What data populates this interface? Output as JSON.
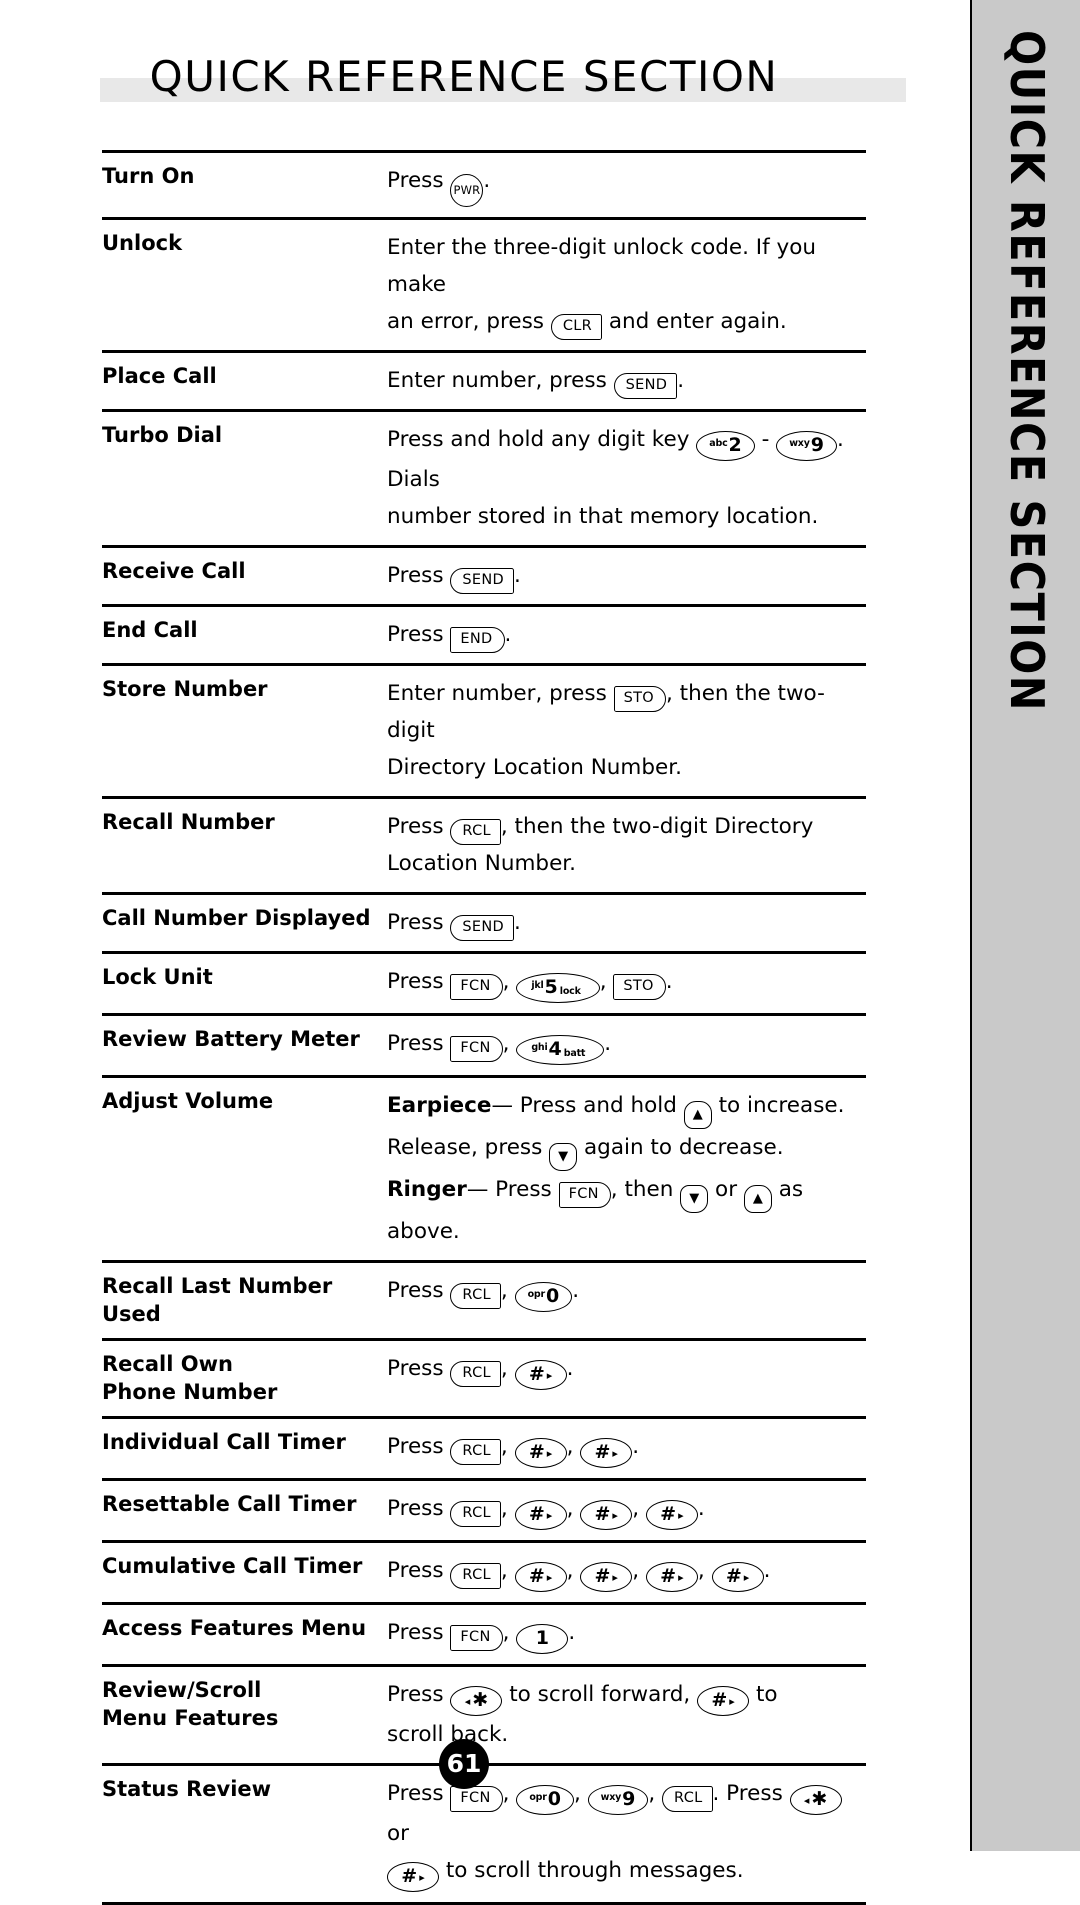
{
  "header": {
    "title": "QUICK REFERENCE SECTION",
    "band_color": "#e8e8e8"
  },
  "side_tab": {
    "label": "QUICK REFERENCE SECTION",
    "background": "#c9c9c9"
  },
  "page_number": "61",
  "keys": {
    "pwr": "PWR",
    "clr": "CLR",
    "send": "SEND",
    "end": "END",
    "sto": "STO",
    "rcl": "RCL",
    "fcn": "FCN",
    "digit_1": "1",
    "digit_2": "2",
    "digit_2_letters": "abc",
    "digit_4": "4",
    "digit_4_letters": "ghi",
    "digit_4_sub": "batt",
    "digit_5": "5",
    "digit_5_letters": "jkl",
    "digit_5_sub": "lock",
    "digit_9": "9",
    "digit_9_letters": "wxy",
    "digit_0": "0",
    "digit_0_letters": "opr",
    "hash": "#",
    "star": "✱",
    "tri_right": "▸",
    "tri_left": "◂",
    "arrow_up": "▲",
    "arrow_down": "▼"
  },
  "rows": [
    {
      "label": "Turn On",
      "lines": [
        [
          {
            "t": "text",
            "v": "Press "
          },
          {
            "t": "key",
            "k": "pwr",
            "s": "circ"
          },
          {
            "t": "text",
            "v": "."
          }
        ]
      ]
    },
    {
      "label": "Unlock",
      "lines": [
        [
          {
            "t": "text",
            "v": "Enter the three-digit unlock code. If you make"
          }
        ],
        [
          {
            "t": "text",
            "v": "an error, press "
          },
          {
            "t": "key",
            "k": "clr",
            "s": "lrs"
          },
          {
            "t": "text",
            "v": " and enter again."
          }
        ]
      ]
    },
    {
      "label": "Place Call",
      "lines": [
        [
          {
            "t": "text",
            "v": "Enter number, press "
          },
          {
            "t": "key",
            "k": "send",
            "s": "lrs"
          },
          {
            "t": "text",
            "v": "."
          }
        ]
      ]
    },
    {
      "label": "Turbo Dial",
      "lines": [
        [
          {
            "t": "text",
            "v": "Press and hold any digit key "
          },
          {
            "t": "digit",
            "sup": "digit_2_letters",
            "num": "digit_2"
          },
          {
            "t": "text",
            "v": " - "
          },
          {
            "t": "digit",
            "sup": "digit_9_letters",
            "num": "digit_9"
          },
          {
            "t": "text",
            "v": ". Dials"
          }
        ],
        [
          {
            "t": "text",
            "v": "number stored in that memory location."
          }
        ]
      ]
    },
    {
      "label": "Receive Call",
      "lines": [
        [
          {
            "t": "text",
            "v": "Press "
          },
          {
            "t": "key",
            "k": "send",
            "s": "lrs"
          },
          {
            "t": "text",
            "v": "."
          }
        ]
      ]
    },
    {
      "label": "End Call",
      "lines": [
        [
          {
            "t": "text",
            "v": "Press "
          },
          {
            "t": "key",
            "k": "end",
            "s": "srr"
          },
          {
            "t": "text",
            "v": "."
          }
        ]
      ]
    },
    {
      "label": "Store Number",
      "lines": [
        [
          {
            "t": "text",
            "v": "Enter number, press "
          },
          {
            "t": "key",
            "k": "sto",
            "s": "srr"
          },
          {
            "t": "text",
            "v": ", then the two-digit"
          }
        ],
        [
          {
            "t": "text",
            "v": "Directory Location Number."
          }
        ]
      ]
    },
    {
      "label": "Recall Number",
      "lines": [
        [
          {
            "t": "text",
            "v": "Press "
          },
          {
            "t": "key",
            "k": "rcl",
            "s": "lrs"
          },
          {
            "t": "text",
            "v": ", then the two-digit Directory"
          }
        ],
        [
          {
            "t": "text",
            "v": "Location Number."
          }
        ]
      ]
    },
    {
      "label": "Call Number Displayed",
      "lines": [
        [
          {
            "t": "text",
            "v": "Press "
          },
          {
            "t": "key",
            "k": "send",
            "s": "lrs"
          },
          {
            "t": "text",
            "v": "."
          }
        ]
      ]
    },
    {
      "label": "Lock Unit",
      "lines": [
        [
          {
            "t": "text",
            "v": "Press "
          },
          {
            "t": "key",
            "k": "fcn",
            "s": "srr"
          },
          {
            "t": "text",
            "v": ", "
          },
          {
            "t": "digit",
            "sup": "digit_5_letters",
            "num": "digit_5",
            "sub": "digit_5_sub"
          },
          {
            "t": "text",
            "v": ", "
          },
          {
            "t": "key",
            "k": "sto",
            "s": "srr"
          },
          {
            "t": "text",
            "v": "."
          }
        ]
      ]
    },
    {
      "label": "Review Battery Meter",
      "lines": [
        [
          {
            "t": "text",
            "v": "Press "
          },
          {
            "t": "key",
            "k": "fcn",
            "s": "srr"
          },
          {
            "t": "text",
            "v": ", "
          },
          {
            "t": "digit",
            "sup": "digit_4_letters",
            "num": "digit_4",
            "sub": "digit_4_sub"
          },
          {
            "t": "text",
            "v": "."
          }
        ]
      ]
    },
    {
      "label": "Adjust Volume",
      "lines": [
        [
          {
            "t": "lead",
            "v": "Earpiece"
          },
          {
            "t": "text",
            "v": "— Press and hold "
          },
          {
            "t": "arrow",
            "dir": "up"
          },
          {
            "t": "text",
            "v": " to increase."
          }
        ],
        [
          {
            "t": "text",
            "v": "Release, press "
          },
          {
            "t": "arrow",
            "dir": "down"
          },
          {
            "t": "text",
            "v": " again to decrease."
          }
        ],
        [
          {
            "t": "lead",
            "v": "Ringer"
          },
          {
            "t": "text",
            "v": "— Press "
          },
          {
            "t": "key",
            "k": "fcn",
            "s": "srr"
          },
          {
            "t": "text",
            "v": ", then "
          },
          {
            "t": "arrow",
            "dir": "down"
          },
          {
            "t": "text",
            "v": " or "
          },
          {
            "t": "arrow",
            "dir": "up"
          },
          {
            "t": "text",
            "v": " as above."
          }
        ]
      ]
    },
    {
      "label": "Recall Last Number Used",
      "lines": [
        [
          {
            "t": "text",
            "v": "Press "
          },
          {
            "t": "key",
            "k": "rcl",
            "s": "lrs"
          },
          {
            "t": "text",
            "v": ", "
          },
          {
            "t": "digit",
            "sup": "digit_0_letters",
            "num": "digit_0"
          },
          {
            "t": "text",
            "v": "."
          }
        ]
      ]
    },
    {
      "label": "Recall Own\nPhone Number",
      "lines": [
        [
          {
            "t": "text",
            "v": "Press "
          },
          {
            "t": "key",
            "k": "rcl",
            "s": "lrs"
          },
          {
            "t": "text",
            "v": ", "
          },
          {
            "t": "hashkey"
          },
          {
            "t": "text",
            "v": "."
          }
        ]
      ]
    },
    {
      "label": "Individual Call Timer",
      "lines": [
        [
          {
            "t": "text",
            "v": "Press "
          },
          {
            "t": "key",
            "k": "rcl",
            "s": "lrs"
          },
          {
            "t": "text",
            "v": ", "
          },
          {
            "t": "hashkey"
          },
          {
            "t": "text",
            "v": ", "
          },
          {
            "t": "hashkey"
          },
          {
            "t": "text",
            "v": "."
          }
        ]
      ]
    },
    {
      "label": "Resettable Call Timer",
      "lines": [
        [
          {
            "t": "text",
            "v": "Press "
          },
          {
            "t": "key",
            "k": "rcl",
            "s": "lrs"
          },
          {
            "t": "text",
            "v": ", "
          },
          {
            "t": "hashkey"
          },
          {
            "t": "text",
            "v": ", "
          },
          {
            "t": "hashkey"
          },
          {
            "t": "text",
            "v": ", "
          },
          {
            "t": "hashkey"
          },
          {
            "t": "text",
            "v": "."
          }
        ]
      ]
    },
    {
      "label": "Cumulative Call Timer",
      "lines": [
        [
          {
            "t": "text",
            "v": "Press "
          },
          {
            "t": "key",
            "k": "rcl",
            "s": "lrs"
          },
          {
            "t": "text",
            "v": ", "
          },
          {
            "t": "hashkey"
          },
          {
            "t": "text",
            "v": ", "
          },
          {
            "t": "hashkey"
          },
          {
            "t": "text",
            "v": ", "
          },
          {
            "t": "hashkey"
          },
          {
            "t": "text",
            "v": ", "
          },
          {
            "t": "hashkey"
          },
          {
            "t": "text",
            "v": "."
          }
        ]
      ]
    },
    {
      "label": "Access Features Menu",
      "lines": [
        [
          {
            "t": "text",
            "v": "Press "
          },
          {
            "t": "key",
            "k": "fcn",
            "s": "srr"
          },
          {
            "t": "text",
            "v": ", "
          },
          {
            "t": "digit",
            "num": "digit_1"
          },
          {
            "t": "text",
            "v": "."
          }
        ]
      ]
    },
    {
      "label": "Review/Scroll\nMenu Features",
      "lines": [
        [
          {
            "t": "text",
            "v": "Press "
          },
          {
            "t": "starkey"
          },
          {
            "t": "text",
            "v": " to scroll forward, "
          },
          {
            "t": "hashkey"
          },
          {
            "t": "text",
            "v": " to"
          }
        ],
        [
          {
            "t": "text",
            "v": "scroll back."
          }
        ]
      ]
    },
    {
      "label": "Status Review",
      "lines": [
        [
          {
            "t": "text",
            "v": "Press "
          },
          {
            "t": "key",
            "k": "fcn",
            "s": "srr"
          },
          {
            "t": "text",
            "v": ", "
          },
          {
            "t": "digit",
            "sup": "digit_0_letters",
            "num": "digit_0"
          },
          {
            "t": "text",
            "v": ", "
          },
          {
            "t": "digit",
            "sup": "digit_9_letters",
            "num": "digit_9"
          },
          {
            "t": "text",
            "v": ", "
          },
          {
            "t": "key",
            "k": "rcl",
            "s": "lrs"
          },
          {
            "t": "text",
            "v": ". Press "
          },
          {
            "t": "starkey"
          },
          {
            "t": "text",
            "v": " or"
          }
        ],
        [
          {
            "t": "hashkey"
          },
          {
            "t": "text",
            "v": " to scroll through messages."
          }
        ]
      ]
    }
  ]
}
